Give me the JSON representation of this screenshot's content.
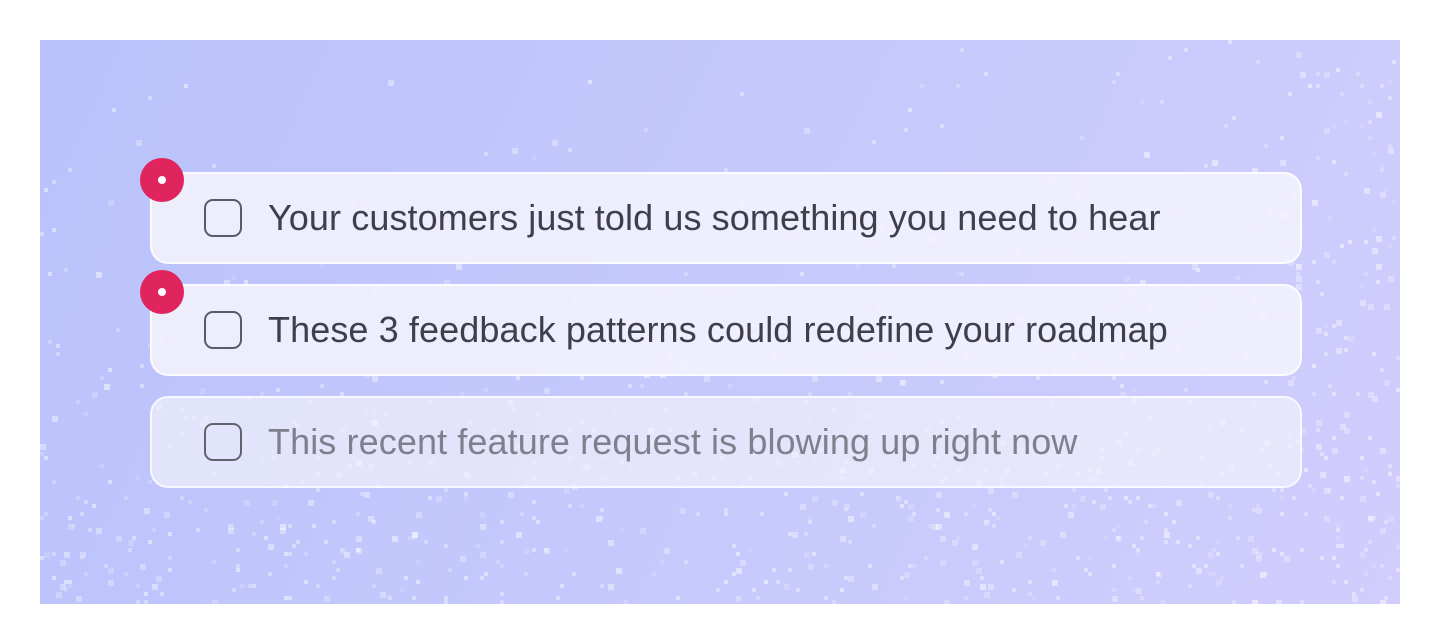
{
  "checklist": {
    "items": [
      {
        "label": "Your customers just told us something you need to hear",
        "checked": false,
        "unread": true
      },
      {
        "label": "These 3 feedback patterns could redefine your roadmap",
        "checked": false,
        "unread": true
      },
      {
        "label": "This recent feature request is blowing up right now",
        "checked": false,
        "unread": false
      }
    ]
  },
  "colors": {
    "background_gradient_start": "#b9c2fb",
    "background_gradient_end": "#d1cdfd",
    "unread_dot": "#e0245e",
    "text_primary": "#3f3f4c",
    "text_muted": "#7f7f8e"
  }
}
